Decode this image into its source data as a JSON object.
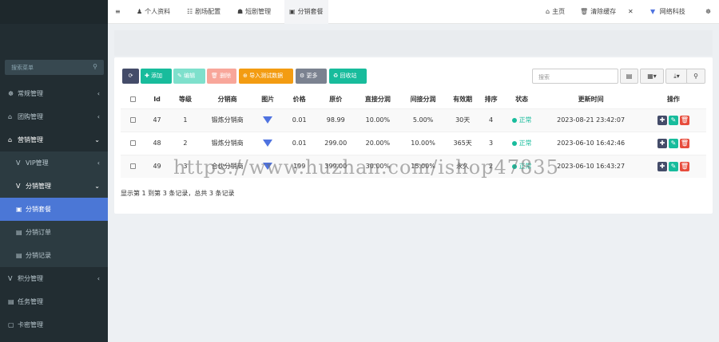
{
  "sidebar": {
    "search_placeholder": "搜索菜单",
    "items": [
      {
        "icon": "☸",
        "label": "常规管理",
        "arrow": "‹"
      },
      {
        "icon": "⌂",
        "label": "团购管理",
        "arrow": "‹"
      },
      {
        "icon": "⌂",
        "label": "营销管理",
        "arrow": "⌄"
      },
      {
        "icon": "V",
        "label": "VIP管理",
        "arrow": "‹"
      },
      {
        "icon": "V",
        "label": "分销管理",
        "arrow": "⌄"
      },
      {
        "icon": "▣",
        "label": "分销套餐",
        "arrow": ""
      },
      {
        "icon": "▤",
        "label": "分销订单",
        "arrow": ""
      },
      {
        "icon": "▤",
        "label": "分销记录",
        "arrow": ""
      },
      {
        "icon": "V",
        "label": "积分管理",
        "arrow": "‹"
      },
      {
        "icon": "▤",
        "label": "任务管理",
        "arrow": ""
      },
      {
        "icon": "▢",
        "label": "卡密管理",
        "arrow": ""
      }
    ]
  },
  "topbar": {
    "menu_icon": "≡",
    "tabs": [
      {
        "icon": "♟",
        "label": "个人资料"
      },
      {
        "icon": "☷",
        "label": "剧场配置"
      },
      {
        "icon": "☗",
        "label": "短剧管理"
      },
      {
        "icon": "▣",
        "label": "分销套餐"
      }
    ],
    "right": [
      {
        "icon": "⌂",
        "label": "主页"
      },
      {
        "icon": "🗑",
        "label": "清除缓存"
      },
      {
        "icon": "✕",
        "label": ""
      },
      {
        "icon": "▼",
        "label": "网络科技"
      },
      {
        "icon": "☸",
        "label": ""
      }
    ]
  },
  "toolbar": {
    "refresh": "⟳",
    "add": "✚ 添加",
    "edit": "✎ 编辑",
    "delete": "🗑 删除",
    "import": "⊕ 导入测试数据",
    "more": "⚙ 更多",
    "recycle": "♻ 回收站",
    "search_placeholder": "搜索",
    "tool_list": "▤",
    "tool_cols": "▦▾",
    "tool_export": "⤓▾",
    "tool_search": "⚲"
  },
  "table": {
    "headers": [
      "",
      "Id",
      "等级",
      "分销商",
      "图片",
      "价格",
      "原价",
      "直接分润",
      "间接分润",
      "有效期",
      "排序",
      "状态",
      "更新时间",
      "操作"
    ],
    "rows": [
      {
        "id": "47",
        "level": "1",
        "name": "锻炼分销商",
        "price": "0.01",
        "orig": "98.99",
        "direct": "10.00%",
        "indirect": "5.00%",
        "valid": "30天",
        "sort": "4",
        "status": "正常",
        "updated": "2023-08-21 23:42:07"
      },
      {
        "id": "48",
        "level": "2",
        "name": "锻炼分销商",
        "price": "0.01",
        "orig": "299.00",
        "direct": "20.00%",
        "indirect": "10.00%",
        "valid": "365天",
        "sort": "3",
        "status": "正常",
        "updated": "2023-06-10 16:42:46"
      },
      {
        "id": "49",
        "level": "3",
        "name": "合伙分销商",
        "price": "199",
        "orig": "399.00",
        "direct": "30.00%",
        "indirect": "15.00%",
        "valid": "永久",
        "sort": "2",
        "status": "正常",
        "updated": "2023-06-10 16:43:27"
      }
    ],
    "ops": {
      "detail": "✚",
      "edit": "✎",
      "delete": "🗑"
    }
  },
  "pager": "显示第 1 到第 3 条记录，总共 3 条记录",
  "watermark": "https://www.huzhan.com/ishop47835"
}
